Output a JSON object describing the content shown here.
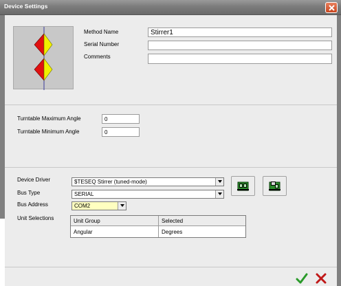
{
  "window": {
    "title": "Device Settings"
  },
  "method": {
    "method_name_label": "Method Name",
    "method_name_value": "Stirrer1",
    "serial_number_label": "Serial Number",
    "serial_number_value": "",
    "comments_label": "Comments",
    "comments_value": ""
  },
  "turntable": {
    "max_angle_label": "Turntable Maximum Angle",
    "max_angle_value": "0",
    "min_angle_label": "Turntable Minimum Angle",
    "min_angle_value": "0"
  },
  "device": {
    "driver_label": "Device Driver",
    "driver_value": "$TESEQ Stirrer (tuned-mode)",
    "bus_type_label": "Bus Type",
    "bus_type_value": "SERIAL",
    "bus_address_label": "Bus Address",
    "bus_address_value": "COM2",
    "unit_selections_label": "Unit Selections"
  },
  "unit_table": {
    "columns": [
      "Unit Group",
      "Selected"
    ],
    "rows": [
      [
        "Angular",
        "Degrees"
      ]
    ]
  },
  "colors": {
    "accent_red": "#e01010",
    "accent_yellow": "#f0f000",
    "title_gradient": "#7c7c7c",
    "address_highlight": "#ffffc0"
  },
  "icons": {
    "close": "close-icon",
    "ok": "checkmark-icon",
    "cancel": "x-icon",
    "device_config_1": "device-config-icon",
    "device_config_2": "device-save-icon",
    "preview": "stirrer-icon"
  }
}
